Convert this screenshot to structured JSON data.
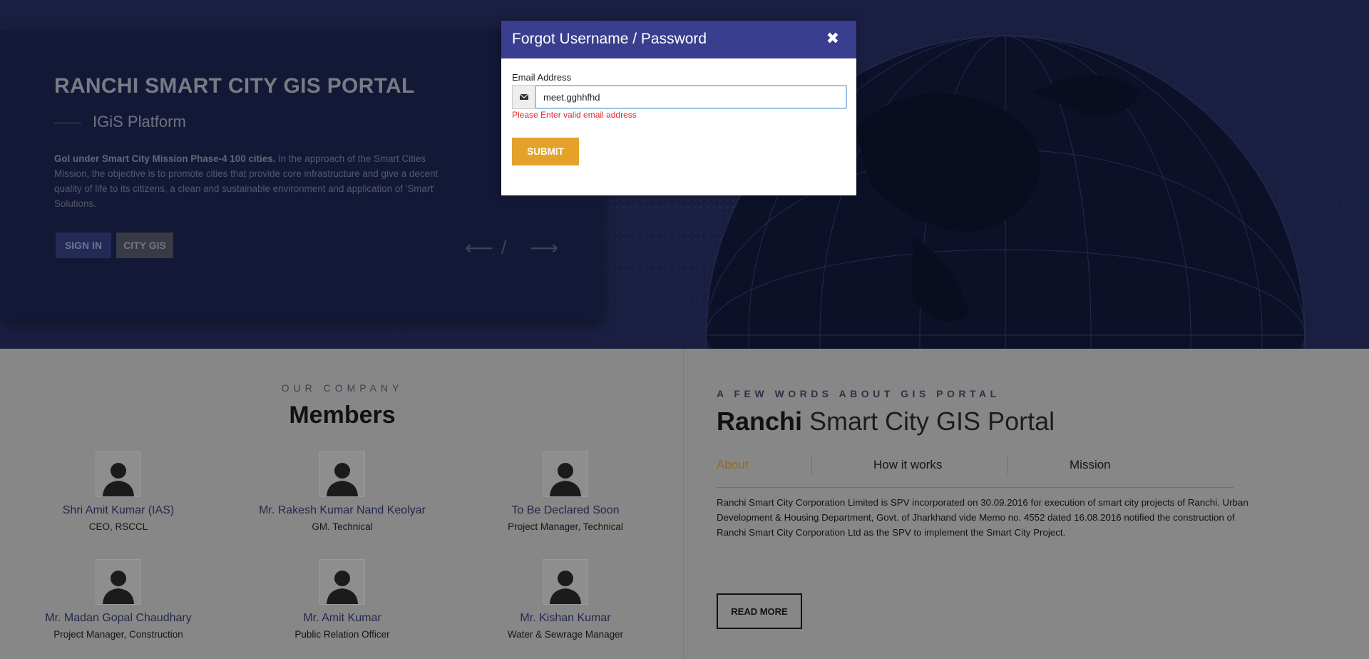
{
  "hero": {
    "title": "RANCHI SMART CITY GIS PORTAL",
    "subtitle": "IGiS Platform",
    "desc_bold": "GoI under Smart City Mission Phase-4 100 cities.",
    "desc_rest": " In the approach of the Smart Cities Mission, the objective is to promote cities that provide core infrastructure and give a decent quality of life to its citizens, a clean and sustainable environment and application of 'Smart' Solutions.",
    "signin_label": "SIGN IN",
    "citygis_label": "CITY GIS",
    "arrow_prev": "⟵",
    "arrow_slash": "/",
    "arrow_next": "⟶"
  },
  "company": {
    "kicker": "OUR COMPANY",
    "title": "Members",
    "members": [
      {
        "name": "Shri Amit Kumar (IAS)",
        "role": "CEO, RSCCL"
      },
      {
        "name": "Mr. Rakesh Kumar Nand Keolyar",
        "role": "GM. Technical"
      },
      {
        "name": "To Be Declared Soon",
        "role": "Project Manager, Technical"
      },
      {
        "name": "Mr. Madan Gopal Chaudhary",
        "role": "Project Manager, Construction"
      },
      {
        "name": "Mr. Amit Kumar",
        "role": "Public Relation Officer"
      },
      {
        "name": "Mr. Kishan Kumar",
        "role": "Water & Sewrage Manager"
      }
    ]
  },
  "about": {
    "kicker": "A FEW WORDS ABOUT GIS PORTAL",
    "title_bold": "Ranchi",
    "title_rest": " Smart City GIS Portal",
    "tabs": [
      "About",
      "How it works",
      "Mission"
    ],
    "active_tab": "About",
    "text": "Ranchi Smart City Corporation Limited is SPV incorporated on 30.09.2016 for execution of smart city projects of Ranchi. Urban Development & Housing Department, Govt. of Jharkhand vide Memo no. 4552 dated 16.08.2016 notified the construction of Ranchi Smart City Corporation Ltd as the SPV to implement the Smart City Project.",
    "read_more_label": "READ MORE"
  },
  "modal": {
    "title": "Forgot Username / Password",
    "close_glyph": "✖",
    "email_label": "Email Address",
    "email_value": "meet.gghhfhd",
    "email_error": "Please Enter valid email address",
    "submit_label": "SUBMIT",
    "envelope_glyph": "✉"
  },
  "colors": {
    "modal_header": "#393f8e",
    "submit": "#e4a22b",
    "error": "#e0282f",
    "active_tab": "#96672a"
  }
}
